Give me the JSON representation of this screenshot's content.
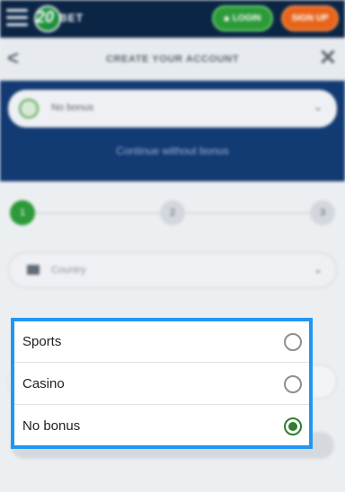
{
  "topbar": {
    "logo_number": "20",
    "logo_text": "BET",
    "login_label": "LOGIN",
    "login_icon": "lock-icon",
    "signup_label": "SIGN UP"
  },
  "header": {
    "title": "CREATE YOUR ACCOUNT",
    "back_icon": "<",
    "close_icon": "✕"
  },
  "bonus": {
    "selected": "No bonus",
    "continue_link": "Continue without bonus"
  },
  "stepper": {
    "steps": [
      "1",
      "2",
      "3"
    ],
    "active": 1
  },
  "country": {
    "placeholder": "Country"
  },
  "dropdown": {
    "options": [
      {
        "label": "Sports",
        "selected": false
      },
      {
        "label": "Casino",
        "selected": false
      },
      {
        "label": "No bonus",
        "selected": true
      }
    ]
  },
  "colors": {
    "topbar": "#0b2545",
    "band": "#123a73",
    "login": "#2b9a38",
    "signup": "#e8641b",
    "focus_border": "#2196f3",
    "radio_selected": "#2e7d32"
  }
}
